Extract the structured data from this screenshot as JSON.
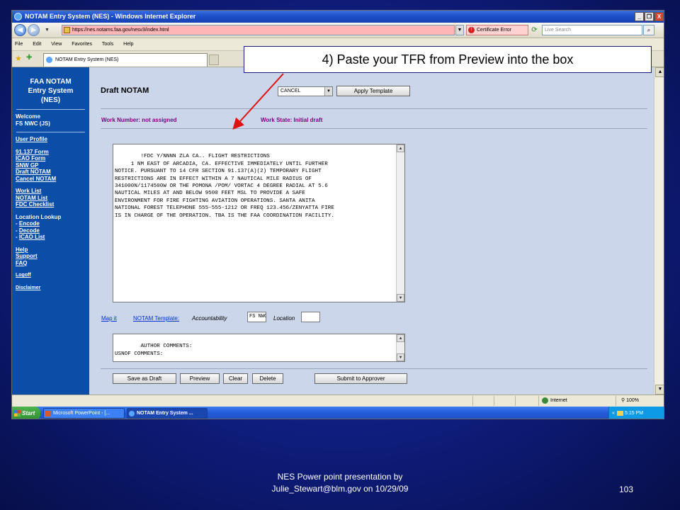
{
  "window": {
    "title": "NOTAM Entry System (NES) - Windows Internet Explorer",
    "buttons": [
      "_",
      "❐",
      "X"
    ]
  },
  "address_bar": {
    "url": "https://nes.notams.faa.gov/nesv3/index.html",
    "cert_error": "Certificate Error",
    "search_placeholder": "Live Search"
  },
  "menu": [
    "File",
    "Edit",
    "View",
    "Favorites",
    "Tools",
    "Help"
  ],
  "tab": {
    "title": "NOTAM Entry System (NES)"
  },
  "sidebar": {
    "brand": [
      "FAA NOTAM",
      "Entry System",
      "(NES)"
    ],
    "welcome": [
      "Welcome",
      "FS NWC (JS)"
    ],
    "user_profile": "User Profile",
    "forms": [
      "91.137 Form",
      "ICAO Form",
      "SNW GP",
      "Draft NOTAM",
      "Cancel NOTAM"
    ],
    "lists": [
      "Work List",
      "NOTAM List",
      "FDC Checklist"
    ],
    "location_lookup": "Location Lookup",
    "lookup_items": [
      "Encode",
      "Decode",
      "ICAO List"
    ],
    "help": [
      "Help",
      "Support",
      "FAQ"
    ],
    "logoff": "Logoff",
    "disclaimer": "Disclaimer"
  },
  "content": {
    "title": "Draft NOTAM",
    "template_select": "CANCEL",
    "apply_template": "Apply Template",
    "work_number": "Work Number: not assigned",
    "work_state": "Work State: Initial draft",
    "notam_text": "!FDC Y/NNNN ZLA CA.. FLIGHT RESTRICTIONS\n     1 NM EAST OF ARCADIA, CA. EFFECTIVE IMMEDIATELY UNTIL FURTHER\nNOTICE. PURSUANT TO 14 CFR SECTION 91.137(A)(2) TEMPORARY FLIGHT\nRESTRICTIONS ARE IN EFFECT WITHIN A 7 NAUTICAL MILE RADIUS OF\n341000N/1174500W OR THE POMONA /POM/ VORTAC 4 DEGREE RADIAL AT 5.6\nNAUTICAL MILES AT AND BELOW 9500 FEET MSL TO PROVIDE A SAFE\nENVIRONMENT FOR FIRE FIGHTING AVIATION OPERATIONS. SANTA ANITA\nNATIONAL FOREST TELEPHONE 555-555-1212 OR FREQ 123.456/ZENYATTA FIRE\nIS IN CHARGE OF THE OPERATION. TBA IS THE FAA COORDINATION FACILITY.",
    "map_it": "Map it",
    "notam_template": "NOTAM Template:",
    "accountability_label": "Accountability",
    "accountability_value": "FS NWC",
    "location_label": "Location",
    "location_value": "",
    "comments_text": "AUTHOR COMMENTS:\nUSNOF COMMENTS:",
    "buttons": {
      "save_draft": "Save as Draft",
      "preview": "Preview",
      "clear": "Clear",
      "delete": "Delete",
      "submit": "Submit to Approver"
    }
  },
  "status_bar": {
    "zone": "Internet",
    "zoom": "100%"
  },
  "taskbar": {
    "start": "Start",
    "tasks": [
      "Microsoft PowerPoint - [...",
      "NOTAM Entry System ..."
    ],
    "time": "5:15 PM"
  },
  "slide": {
    "callout": "4) Paste your TFR from Preview into the box",
    "credit_line1": "NES Power point presentation by",
    "credit_line2": "Julie_Stewart@blm.gov on 10/29/09",
    "number": "103"
  }
}
